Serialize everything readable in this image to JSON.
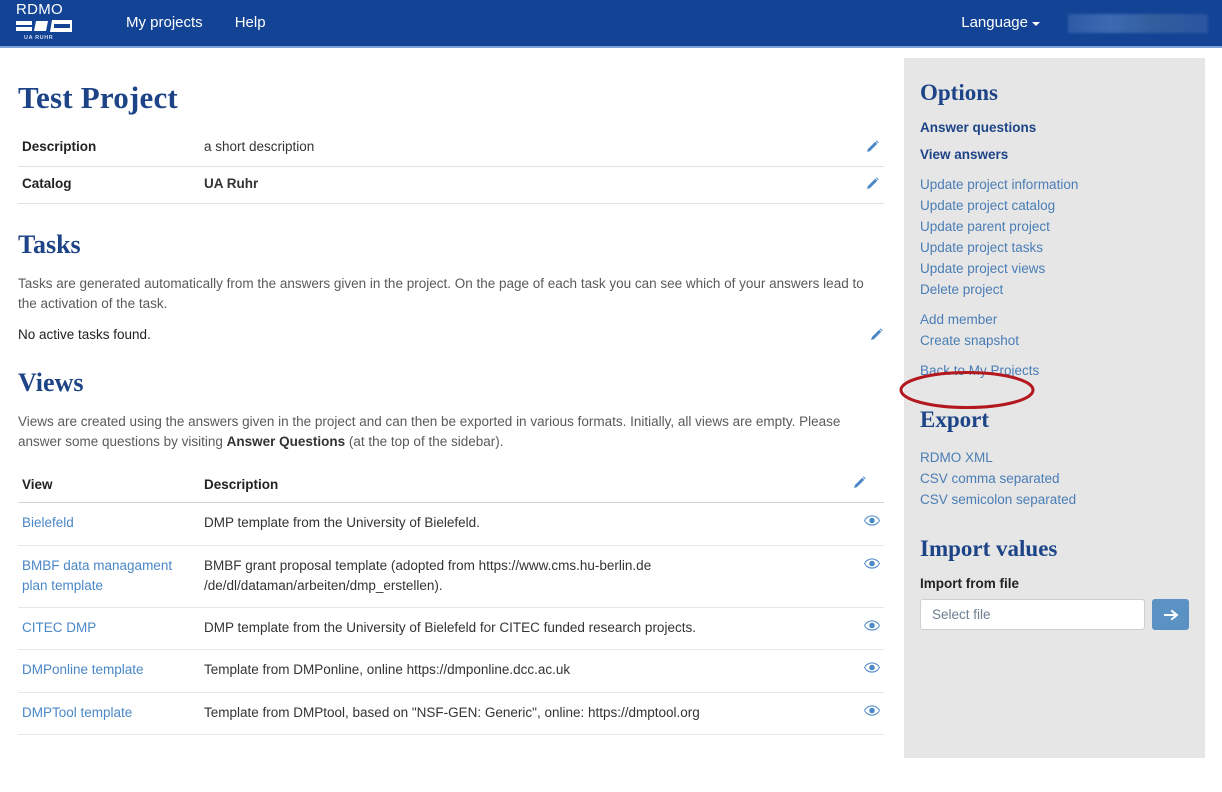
{
  "navbar": {
    "brand_text": "RDMO",
    "brand_sub": "UA RUHR",
    "links": [
      {
        "label": "My projects"
      },
      {
        "label": "Help"
      }
    ],
    "language_label": "Language",
    "user_redacted": ""
  },
  "main": {
    "page_title": "Test Project",
    "details": {
      "rows": [
        {
          "key": "Description",
          "value": "a short description",
          "bold_value": false
        },
        {
          "key": "Catalog",
          "value": "UA Ruhr",
          "bold_value": true
        }
      ]
    },
    "tasks": {
      "title": "Tasks",
      "description": "Tasks are generated automatically from the answers given in the project. On the page of each task you can see which of your answers lead to the activation of the task.",
      "empty_text": "No active tasks found."
    },
    "views": {
      "title": "Views",
      "description_part1": "Views are created using the answers given in the project and can then be exported in various formats. Initially, all views are empty. Please answer some questions by visiting ",
      "description_bold": "Answer Questions",
      "description_part2": " (at the top of the sidebar).",
      "columns": {
        "view": "View",
        "description": "Description"
      },
      "rows": [
        {
          "name": "Bielefeld",
          "description": "DMP template from the University of Bielefeld."
        },
        {
          "name": "BMBF data managament plan template",
          "description": "BMBF grant proposal template (adopted from https://www.cms.hu-berlin.de /de/dl/dataman/arbeiten/dmp_erstellen)."
        },
        {
          "name": "CITEC DMP",
          "description": "DMP template from the University of Bielefeld for CITEC funded research projects."
        },
        {
          "name": "DMPonline template",
          "description": "Template from DMPonline, online https://dmponline.dcc.ac.uk"
        },
        {
          "name": "DMPTool template",
          "description": "Template from DMPtool, based on \"NSF-GEN: Generic\", online: https://dmptool.org"
        }
      ]
    }
  },
  "sidebar": {
    "options": {
      "title": "Options",
      "primary_links": [
        {
          "label": "Answer questions"
        },
        {
          "label": "View answers"
        }
      ],
      "links": [
        {
          "label": "Update project information"
        },
        {
          "label": "Update project catalog"
        },
        {
          "label": "Update parent project"
        },
        {
          "label": "Update project tasks"
        },
        {
          "label": "Update project views"
        },
        {
          "label": "Delete project"
        },
        {
          "label": "Add member"
        },
        {
          "label": "Create snapshot"
        },
        {
          "label": "Back to My Projects"
        }
      ]
    },
    "export": {
      "title": "Export",
      "links": [
        {
          "label": "RDMO XML"
        },
        {
          "label": "CSV comma separated"
        },
        {
          "label": "CSV semicolon separated"
        }
      ]
    },
    "import": {
      "title": "Import values",
      "label": "Import from file",
      "file_placeholder": "Select file",
      "submit_icon": "arrow-right-icon"
    }
  },
  "annotation": {
    "shape": "red-ellipse",
    "target": "Add member",
    "color": "#b4181f"
  },
  "colors": {
    "navbar_bg": "#124395",
    "navbar_border": "#7ba3d9",
    "heading": "#1d4487",
    "link": "#4a7db5",
    "sidebar_bg": "#e6e6e6",
    "accent_button": "#5b92c4",
    "annotation_red": "#b4181f"
  }
}
